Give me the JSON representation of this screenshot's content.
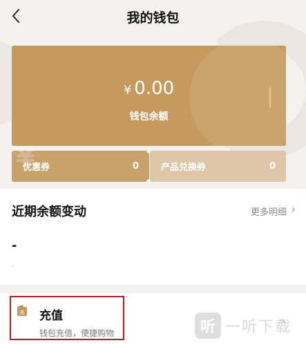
{
  "nav": {
    "title": "我的钱包"
  },
  "wallet": {
    "currency_symbol": "¥",
    "balance": "0.00",
    "balance_label": "钱包余额"
  },
  "coupons": [
    {
      "label": "优惠券",
      "count": "0"
    },
    {
      "label": "产品兑换券",
      "count": "0"
    }
  ],
  "recent": {
    "title": "近期余额变动",
    "more_label": "更多明细",
    "value": "-",
    "sub_value": "-"
  },
  "recharge": {
    "icon_text": "充",
    "title": "充值",
    "subtitle": "钱包充值，便捷购物"
  },
  "watermark": {
    "logo_text": "听",
    "text": "一听下载"
  },
  "colors": {
    "card_gold": "#c59a5c",
    "coupon_left": "#c9a16b",
    "coupon_right": "#ddc7a8",
    "highlight_border": "#c8151d",
    "background_light": "#f4f2f0"
  }
}
